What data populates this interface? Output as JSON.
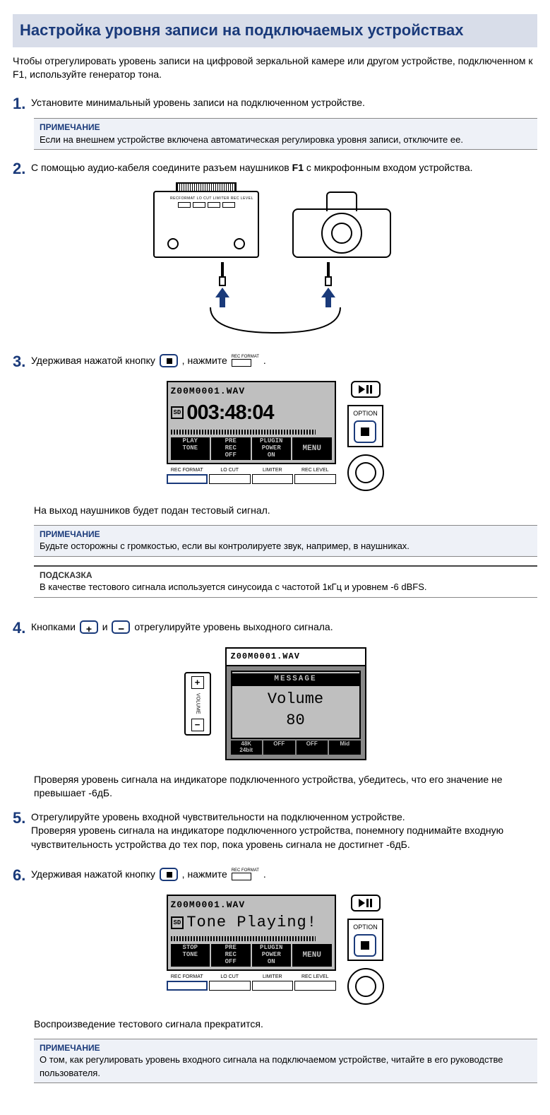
{
  "title": "Настройка уровня записи на подключаемых устройствах",
  "intro": "Чтобы отрегулировать уровень записи на цифровой зеркальной камере или другом устройстве, подключенном к F1, используйте генератор тона.",
  "steps": {
    "s1": {
      "num": "1.",
      "text": "Установите минимальный уровень записи на подключенном устройстве.",
      "note_title": "ПРИМЕЧАНИЕ",
      "note_text": "Если на внешнем устройстве включена автоматическая регулировка уровня записи, отключите ее."
    },
    "s2": {
      "num": "2.",
      "text_a": "С помощью аудио-кабеля соедините разъем наушников ",
      "text_bold": "F1",
      "text_b": " с микрофонным входом устройства."
    },
    "s3": {
      "num": "3.",
      "text_a": "Удерживая нажатой кнопку ",
      "text_mid": ", нажмите ",
      "text_end": ".",
      "rec_format": "REC FORMAT",
      "after": "На выход наушников будет подан тестовый сигнал.",
      "note_title": "ПРИМЕЧАНИЕ",
      "note_text": "Будьте осторожны с громкостью, если вы контролируете звук, например, в наушниках.",
      "hint_title": "ПОДСКАЗКА",
      "hint_text": "В качестве тестового сигнала используется синусоида с частотой 1кГц и уровнем -6 dBFS."
    },
    "s4": {
      "num": "4.",
      "text_a": "Кнопками ",
      "text_mid": " и ",
      "text_b": " отрегулируйте уровень выходного сигнала.",
      "after": "Проверяя уровень сигнала на индикаторе подключенного устройства, убедитесь, что его значение не превышает -6дБ."
    },
    "s5": {
      "num": "5.",
      "text": "Отрегулируйте уровень входной чувствительности на подключенном устройстве.",
      "text2": "Проверяя уровень сигнала на индикаторе подключенного устройства, понемногу поднимайте входную чувствительность устройства до тех пор, пока уровень сигнала не достигнет -6дБ."
    },
    "s6": {
      "num": "6.",
      "text_a": "Удерживая нажатой кнопку ",
      "text_mid": ", нажмите ",
      "text_end": ".",
      "rec_format": "REC FORMAT",
      "after": "Воспроизведение тестового сигнала прекратится.",
      "note_title": "ПРИМЕЧАНИЕ",
      "note_text": "О том, как регулировать уровень входного сигнала на подключаемом устройстве, читайте в его руководстве пользователя."
    }
  },
  "lcd": {
    "fname": "Z00M0001.WAV",
    "sd": "SD",
    "time": "003:48:04",
    "sk_play_tone_1": "PLAY",
    "sk_play_tone_2": "TONE",
    "sk_stop_tone_1": "STOP",
    "sk_stop_tone_2": "TONE",
    "sk_prerec_1": "PRE",
    "sk_prerec_2": "REC",
    "sk_prerec_3": "OFF",
    "sk_plugin_1": "PLUGIN",
    "sk_plugin_2": "POWER",
    "sk_plugin_3": "ON",
    "sk_menu": "MENU",
    "hw_rec_format": "REC FORMAT",
    "hw_locut": "LO CUT",
    "hw_limiter": "LIMITER",
    "hw_reclevel": "REC LEVEL",
    "option": "OPTION",
    "tone_playing": "Tone Playing!"
  },
  "vol": {
    "fname": "Z00M0001.WAV",
    "msg_hdr": "MESSAGE",
    "msg_txt": "Volume",
    "msg_val": "80",
    "btm_1a": "48K",
    "btm_1b": "24bit",
    "btm_2": "OFF",
    "btm_3": "OFF",
    "btm_4": "Mid",
    "slider_label": "VOLUME"
  },
  "device": {
    "tiny_labels": "RECFORMAT LO CUT LIMITER REC LEVEL"
  }
}
